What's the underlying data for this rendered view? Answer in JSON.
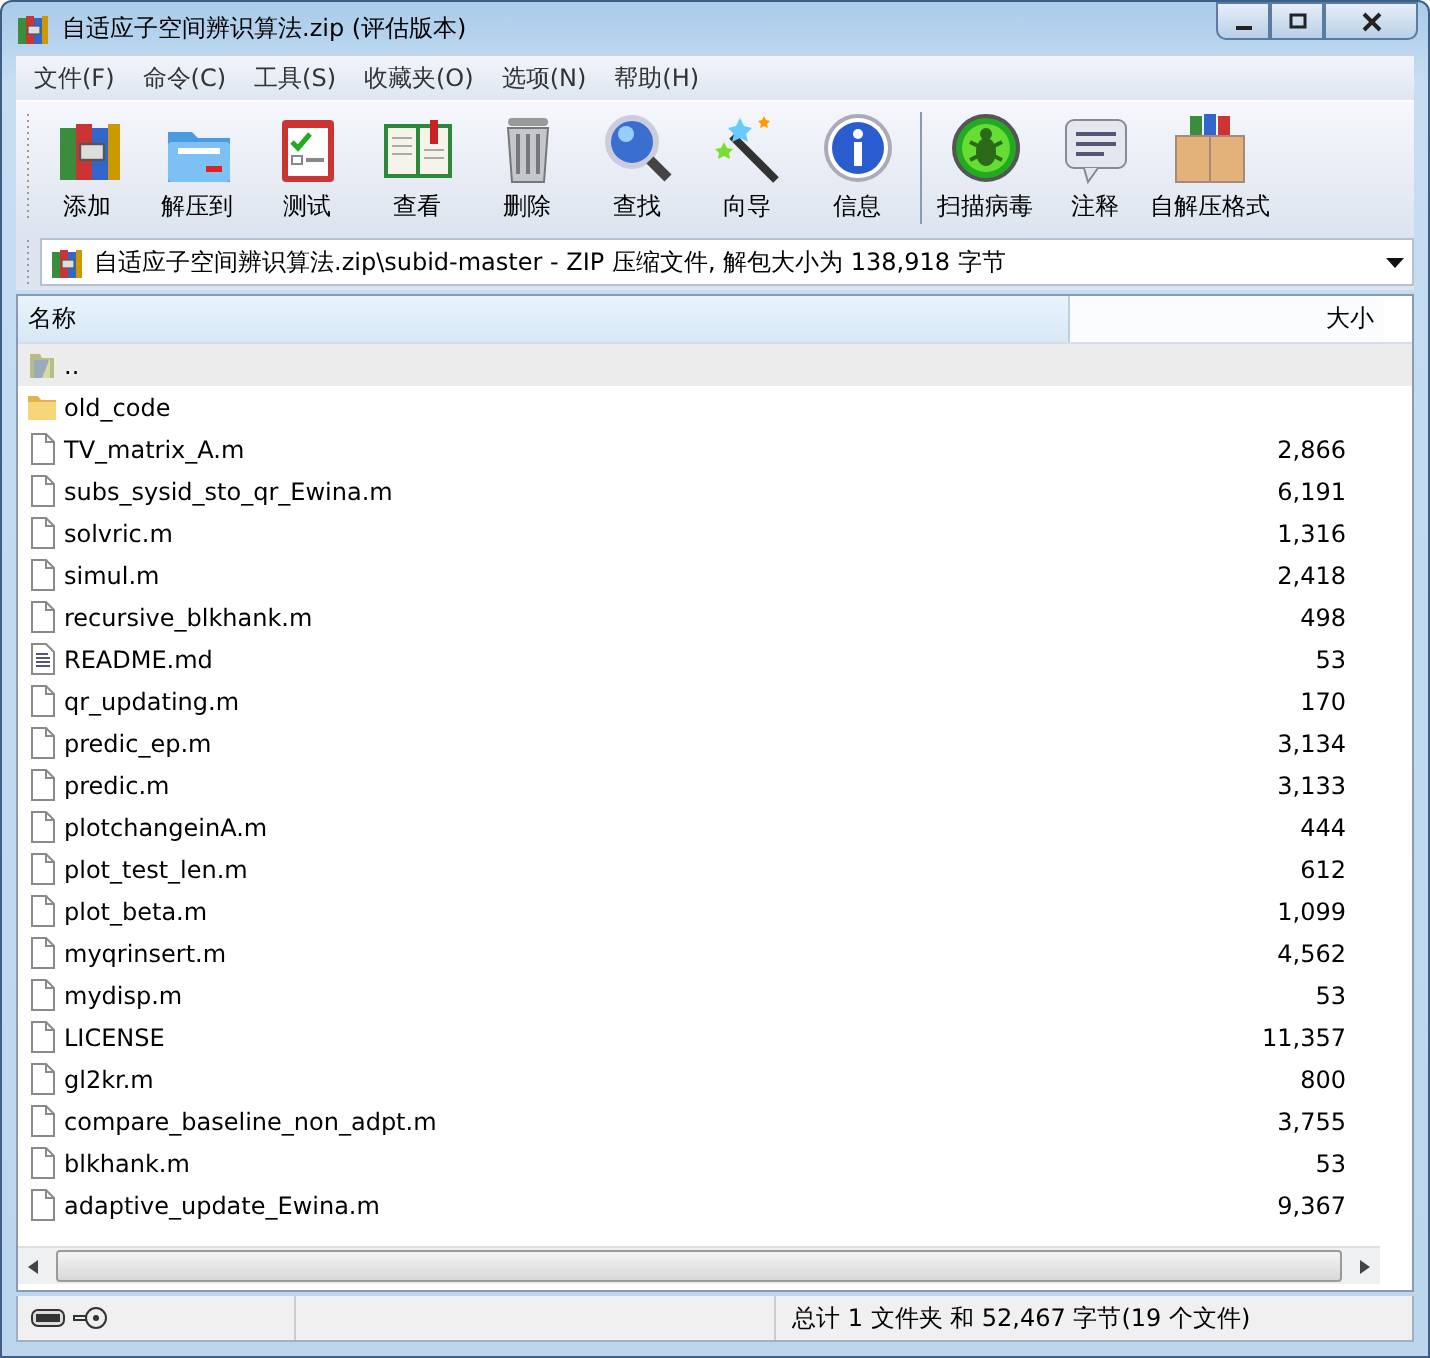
{
  "window": {
    "title": "自适应子空间辨识算法.zip (评估版本)"
  },
  "menu": [
    "文件(F)",
    "命令(C)",
    "工具(S)",
    "收藏夹(O)",
    "选项(N)",
    "帮助(H)"
  ],
  "toolbar": [
    {
      "label": "添加"
    },
    {
      "label": "解压到"
    },
    {
      "label": "测试"
    },
    {
      "label": "查看"
    },
    {
      "label": "删除"
    },
    {
      "label": "查找"
    },
    {
      "label": "向导"
    },
    {
      "label": "信息"
    },
    {
      "label": "扫描病毒"
    },
    {
      "label": "注释"
    },
    {
      "label": "自解压格式"
    }
  ],
  "address": "自适应子空间辨识算法.zip\\subid-master - ZIP 压缩文件, 解包大小为 138,918 字节",
  "table": {
    "columns": [
      "名称",
      "大小"
    ],
    "rows": [
      {
        "kind": "parent",
        "name": "..",
        "size": "",
        "selected": true
      },
      {
        "kind": "folder",
        "name": "old_code",
        "size": "",
        "selected": false
      },
      {
        "kind": "file",
        "name": "TV_matrix_A.m",
        "size": "2,866",
        "selected": false
      },
      {
        "kind": "file",
        "name": "subs_sysid_sto_qr_Ewina.m",
        "size": "6,191",
        "selected": false
      },
      {
        "kind": "file",
        "name": "solvric.m",
        "size": "1,316",
        "selected": false
      },
      {
        "kind": "file",
        "name": "simul.m",
        "size": "2,418",
        "selected": false
      },
      {
        "kind": "file",
        "name": "recursive_blkhank.m",
        "size": "498",
        "selected": false
      },
      {
        "kind": "text",
        "name": "README.md",
        "size": "53",
        "selected": false
      },
      {
        "kind": "file",
        "name": "qr_updating.m",
        "size": "170",
        "selected": false
      },
      {
        "kind": "file",
        "name": "predic_ep.m",
        "size": "3,134",
        "selected": false
      },
      {
        "kind": "file",
        "name": "predic.m",
        "size": "3,133",
        "selected": false
      },
      {
        "kind": "file",
        "name": "plotchangeinA.m",
        "size": "444",
        "selected": false
      },
      {
        "kind": "file",
        "name": "plot_test_len.m",
        "size": "612",
        "selected": false
      },
      {
        "kind": "file",
        "name": "plot_beta.m",
        "size": "1,099",
        "selected": false
      },
      {
        "kind": "file",
        "name": "myqrinsert.m",
        "size": "4,562",
        "selected": false
      },
      {
        "kind": "file",
        "name": "mydisp.m",
        "size": "53",
        "selected": false
      },
      {
        "kind": "file",
        "name": "LICENSE",
        "size": "11,357",
        "selected": false
      },
      {
        "kind": "file",
        "name": "gl2kr.m",
        "size": "800",
        "selected": false
      },
      {
        "kind": "file",
        "name": "compare_baseline_non_adpt.m",
        "size": "3,755",
        "selected": false
      },
      {
        "kind": "file",
        "name": "blkhank.m",
        "size": "53",
        "selected": false
      },
      {
        "kind": "file",
        "name": "adaptive_update_Ewina.m",
        "size": "9,367",
        "selected": false
      }
    ]
  },
  "status_bar": {
    "text": "总计 1 文件夹 和 52,467 字节(19 个文件)"
  }
}
